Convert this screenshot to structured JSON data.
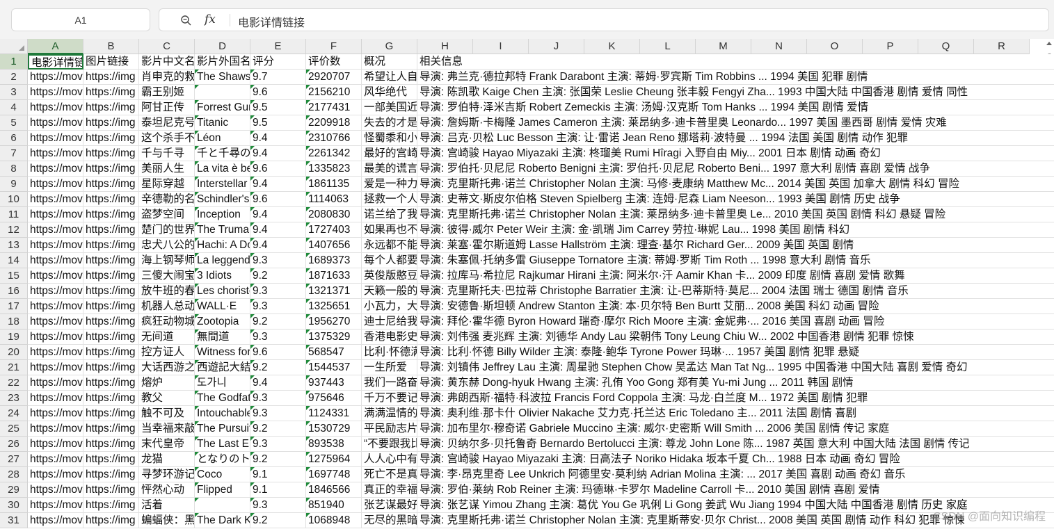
{
  "namebox": {
    "value": "A1"
  },
  "formula": {
    "fx_label": "fx",
    "content": "电影详情链接"
  },
  "columns": [
    "A",
    "B",
    "C",
    "D",
    "E",
    "F",
    "G",
    "H",
    "I",
    "J",
    "K",
    "L",
    "M",
    "N",
    "O",
    "P",
    "Q",
    "R"
  ],
  "active_column": "A",
  "active_row": "1",
  "rows": [
    {
      "num": "1",
      "a": "电影详情链接",
      "b": "图片链接",
      "c": "影片中文名",
      "d": "影片外国名",
      "e": "评分",
      "f": "评价数",
      "g": "概况",
      "h": "相关信息"
    },
    {
      "num": "2",
      "a": "https://mov",
      "b": "https://img",
      "c": "肖申克的救赎",
      "d": "The Shawshank",
      "e": "9.7",
      "f": "2920707",
      "g": "希望让人自由",
      "h": "导演: 弗兰克·德拉邦特 Frank Darabont   主演: 蒂姆·罗宾斯 Tim Robbins  ... 1994   美国   犯罪 剧情"
    },
    {
      "num": "3",
      "a": "https://mov",
      "b": "https://img",
      "c": "霸王别姬",
      "d": "",
      "e": "9.6",
      "f": "2156210",
      "g": "风华绝代",
      "h": "导演: 陈凯歌 Kaige Chen   主演: 张国荣 Leslie Cheung   张丰毅 Fengyi Zha... 1993   中国大陆 中国香港   剧情 爱情 同性"
    },
    {
      "num": "4",
      "a": "https://mov",
      "b": "https://img",
      "c": "阿甘正传",
      "d": "Forrest Gump",
      "e": "9.5",
      "f": "2177431",
      "g": "一部美国近现代史",
      "h": "导演: 罗伯特·泽米吉斯 Robert Zemeckis   主演: 汤姆·汉克斯 Tom Hanks   ... 1994   美国   剧情 爱情"
    },
    {
      "num": "5",
      "a": "https://mov",
      "b": "https://img",
      "c": "泰坦尼克号",
      "d": "Titanic",
      "e": "9.5",
      "f": "2209918",
      "g": "失去的才是永恒的",
      "h": "导演: 詹姆斯·卡梅隆 James Cameron   主演: 莱昂纳多·迪卡普里奥 Leonardo... 1997   美国 墨西哥   剧情 爱情 灾难"
    },
    {
      "num": "6",
      "a": "https://mov",
      "b": "https://img",
      "c": "这个杀手不太冷",
      "d": "Léon",
      "e": "9.4",
      "f": "2310766",
      "g": "怪蜀黍和小萝莉",
      "h": "导演: 吕克·贝松 Luc Besson   主演: 让·雷诺 Jean Reno   娜塔莉·波特曼 ... 1994   法国 美国   剧情 动作 犯罪"
    },
    {
      "num": "7",
      "a": "https://mov",
      "b": "https://img",
      "c": "千与千寻",
      "d": "千と千尋の神隠し",
      "e": "9.4",
      "f": "2261342",
      "g": "最好的宫崎骏",
      "h": "导演: 宫崎骏 Hayao Miyazaki   主演: 柊瑠美 Rumi Hîragi   入野自由 Miy... 2001   日本   剧情 动画 奇幻"
    },
    {
      "num": "8",
      "a": "https://mov",
      "b": "https://img",
      "c": "美丽人生",
      "d": "La vita è bella",
      "e": "9.6",
      "f": "1335823",
      "g": "最美的谎言",
      "h": "导演: 罗伯托·贝尼尼 Roberto Benigni   主演: 罗伯托·贝尼尼 Roberto Beni... 1997   意大利   剧情 喜剧 爱情 战争"
    },
    {
      "num": "9",
      "a": "https://mov",
      "b": "https://img",
      "c": "星际穿越",
      "d": "Interstellar",
      "e": "9.4",
      "f": "1861135",
      "g": "爱是一种力量",
      "h": "导演: 克里斯托弗·诺兰 Christopher Nolan   主演: 马修·麦康纳 Matthew Mc... 2014   美国 英国 加拿大   剧情 科幻 冒险"
    },
    {
      "num": "10",
      "a": "https://mov",
      "b": "https://img",
      "c": "辛德勒的名单",
      "d": "Schindler's List",
      "e": "9.6",
      "f": "1114063",
      "g": "拯救一个人",
      "h": "导演: 史蒂文·斯皮尔伯格 Steven Spielberg   主演: 连姆·尼森 Liam Neeson... 1993   美国   剧情 历史 战争"
    },
    {
      "num": "11",
      "a": "https://mov",
      "b": "https://img",
      "c": "盗梦空间",
      "d": "Inception",
      "e": "9.4",
      "f": "2080830",
      "g": "诺兰给了我们",
      "h": "导演: 克里斯托弗·诺兰 Christopher Nolan   主演: 莱昂纳多·迪卡普里奥 Le... 2010   美国 英国   剧情 科幻 悬疑 冒险"
    },
    {
      "num": "12",
      "a": "https://mov",
      "b": "https://img",
      "c": "楚门的世界",
      "d": "The Truman Show",
      "e": "9.4",
      "f": "1727403",
      "g": "如果再也不能见到你",
      "h": "导演: 彼得·威尔 Peter Weir   主演: 金·凯瑞 Jim Carrey   劳拉·琳妮 Lau... 1998   美国   剧情 科幻"
    },
    {
      "num": "13",
      "a": "https://mov",
      "b": "https://img",
      "c": "忠犬八公的故事",
      "d": "Hachi: A Dog's Tale",
      "e": "9.4",
      "f": "1407656",
      "g": "永远都不能忘记",
      "h": "导演: 莱塞·霍尔斯道姆 Lasse Hallström   主演: 理查·基尔 Richard Ger... 2009   美国 英国   剧情"
    },
    {
      "num": "14",
      "a": "https://mov",
      "b": "https://img",
      "c": "海上钢琴师",
      "d": "La leggenda",
      "e": "9.3",
      "f": "1689373",
      "g": "每个人都要走一条",
      "h": "导演: 朱塞佩·托纳多雷 Giuseppe Tornatore   主演: 蒂姆·罗斯 Tim Roth   ... 1998   意大利   剧情 音乐"
    },
    {
      "num": "15",
      "a": "https://mov",
      "b": "https://img",
      "c": "三傻大闹宝莱坞",
      "d": "3 Idiots",
      "e": "9.2",
      "f": "1871633",
      "g": "英俊版憨豆",
      "h": "导演: 拉库马·希拉尼 Rajkumar Hirani   主演: 阿米尔·汗 Aamir Khan   卡... 2009   印度   剧情 喜剧 爱情 歌舞"
    },
    {
      "num": "16",
      "a": "https://mov",
      "b": "https://img",
      "c": "放牛班的春天",
      "d": "Les choristes",
      "e": "9.3",
      "f": "1321371",
      "g": "天籁一般的童声",
      "h": "导演: 克里斯托夫·巴拉蒂 Christophe Barratier   主演: 让-巴蒂斯特·莫尼... 2004   法国 瑞士 德国   剧情 音乐"
    },
    {
      "num": "17",
      "a": "https://mov",
      "b": "https://img",
      "c": "机器人总动员",
      "d": "WALL·E",
      "e": "9.3",
      "f": "1325651",
      "g": "小瓦力，大人生",
      "h": "导演: 安德鲁·斯坦顿 Andrew Stanton   主演: 本·贝尔特 Ben Burtt   艾丽... 2008   美国   科幻 动画 冒险"
    },
    {
      "num": "18",
      "a": "https://mov",
      "b": "https://img",
      "c": "疯狂动物城",
      "d": "Zootopia",
      "e": "9.2",
      "f": "1956270",
      "g": "迪士尼给我们",
      "h": "导演: 拜伦·霍华德 Byron Howard   瑞奇·摩尔 Rich Moore   主演: 金妮弗·... 2016   美国   喜剧 动画 冒险"
    },
    {
      "num": "19",
      "a": "https://mov",
      "b": "https://img",
      "c": "无间道",
      "d": "無間道",
      "e": "9.3",
      "f": "1375329",
      "g": "香港电影史上",
      "h": "导演: 刘伟强   麦兆辉   主演: 刘德华 Andy Lau   梁朝伟 Tony Leung Chiu W... 2002   中国香港   剧情 犯罪 惊悚"
    },
    {
      "num": "20",
      "a": "https://mov",
      "b": "https://img",
      "c": "控方证人",
      "d": "Witness for",
      "e": "9.6",
      "f": "568547",
      "g": "比利·怀德满分",
      "h": "导演: 比利·怀德 Billy Wilder   主演: 泰隆·鲍华 Tyrone Power   玛琳·... 1957   美国   剧情 犯罪 悬疑"
    },
    {
      "num": "21",
      "a": "https://mov",
      "b": "https://img",
      "c": "大话西游之大圣娶亲",
      "d": "西遊記大結局",
      "e": "9.2",
      "f": "1544537",
      "g": "一生所爱",
      "h": "导演: 刘镇伟 Jeffrey Lau   主演: 周星驰 Stephen Chow   吴孟达 Man Tat Ng... 1995   中国香港 中国大陆   喜剧 爱情 奇幻"
    },
    {
      "num": "22",
      "a": "https://mov",
      "b": "https://img",
      "c": "熔炉",
      "d": "도가니",
      "e": "9.4",
      "f": "937443",
      "g": "我们一路奋战",
      "h": "导演: 黄东赫 Dong-hyuk Hwang   主演: 孔侑 Yoo Gong   郑有美 Yu-mi Jung   ... 2011   韩国   剧情"
    },
    {
      "num": "23",
      "a": "https://mov",
      "b": "https://img",
      "c": "教父",
      "d": "The Godfather",
      "e": "9.3",
      "f": "975646",
      "g": "千万不要记恨",
      "h": "导演: 弗朗西斯·福特·科波拉 Francis Ford Coppola   主演: 马龙·白兰度 M... 1972   美国   剧情 犯罪"
    },
    {
      "num": "24",
      "a": "https://mov",
      "b": "https://img",
      "c": "触不可及",
      "d": "Intouchables",
      "e": "9.3",
      "f": "1124331",
      "g": "满满温情的高雅",
      "h": "导演: 奥利维·那卡什 Olivier Nakache   艾力克·托兰达 Eric Toledano   主... 2011   法国   剧情 喜剧"
    },
    {
      "num": "25",
      "a": "https://mov",
      "b": "https://img",
      "c": "当幸福来敲门",
      "d": "The Pursuit",
      "e": "9.2",
      "f": "1530729",
      "g": "平民励志片",
      "h": "导演: 加布里尔·穆奇诺 Gabriele Muccino   主演: 威尔·史密斯 Will Smith ... 2006   美国   剧情 传记 家庭"
    },
    {
      "num": "26",
      "a": "https://mov",
      "b": "https://img",
      "c": "末代皇帝",
      "d": "The Last Emperor",
      "e": "9.3",
      "f": "893538",
      "g": "“不要跟我比惨",
      "h": "导演: 贝纳尔多·贝托鲁奇 Bernardo Bertolucci   主演: 尊龙 John Lone   陈... 1987   英国 意大利 中国大陆 法国   剧情 传记"
    },
    {
      "num": "27",
      "a": "https://mov",
      "b": "https://img",
      "c": "龙猫",
      "d": "となりのトトロ",
      "e": "9.2",
      "f": "1275964",
      "g": "人人心中有个",
      "h": "导演: 宫崎骏 Hayao Miyazaki   主演: 日高法子 Noriko Hidaka   坂本千夏 Ch... 1988   日本   动画 奇幻 冒险"
    },
    {
      "num": "28",
      "a": "https://mov",
      "b": "https://img",
      "c": "寻梦环游记",
      "d": "Coco",
      "e": "9.1",
      "f": "1697748",
      "g": "死亡不是真的",
      "h": "导演: 李·昂克里奇 Lee Unkrich   阿德里安·莫利纳 Adrian Molina   主演: ... 2017   美国   喜剧 动画 奇幻 音乐"
    },
    {
      "num": "29",
      "a": "https://mov",
      "b": "https://img",
      "c": "怦然心动",
      "d": "Flipped",
      "e": "9.1",
      "f": "1846566",
      "g": "真正的幸福",
      "h": "导演: 罗伯·莱纳 Rob Reiner   主演: 玛德琳·卡罗尔 Madeline Carroll   卡... 2010   美国   剧情 喜剧 爱情"
    },
    {
      "num": "30",
      "a": "https://mov",
      "b": "https://img",
      "c": "活着",
      "d": "",
      "e": "9.3",
      "f": "851940",
      "g": "张艺谋最好",
      "h": "导演: 张艺谋 Yimou Zhang   主演: 葛优 You Ge   巩俐 Li Gong   姜武 Wu Jiang 1994   中国大陆 中国香港   剧情 历史 家庭"
    },
    {
      "num": "31",
      "a": "https://mov",
      "b": "https://img",
      "c": "蝙蝠侠：黑暗骑士",
      "d": "The Dark Knight",
      "e": "9.2",
      "f": "1068948",
      "g": "无尽的黑暗",
      "h": "导演: 克里斯托弗·诺兰 Christopher Nolan   主演: 克里斯蒂安·贝尔 Christ... 2008   美国 英国   剧情 动作 科幻 犯罪 惊悚"
    }
  ],
  "watermark": "CSDN @面向知识编程"
}
